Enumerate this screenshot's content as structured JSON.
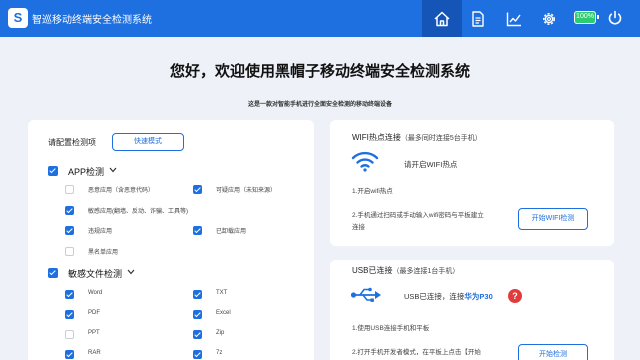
{
  "app": {
    "title": "智巡移动终端安全检测系统",
    "logo_text": "S",
    "nav": [
      {
        "icon": "home-icon"
      },
      {
        "icon": "document-icon"
      },
      {
        "icon": "chart-icon"
      },
      {
        "icon": "gear-icon"
      }
    ],
    "battery": "100%",
    "colors": {
      "primary": "#1e6fe0",
      "accent_red": "#e23b3b",
      "battery_green": "#2ecc71"
    }
  },
  "main": {
    "headline": "您好，欢迎使用黑帽子移动终端安全检测系统",
    "subline": "这是一款对智能手机进行全面安全检测的移动终端设备"
  },
  "config": {
    "title": "请配置检测项",
    "quick_mode": "快速模式",
    "app_group": {
      "label": "APP检测",
      "checked": true,
      "options": [
        {
          "label": "恶意应用（含恶意代码）",
          "checked": false
        },
        {
          "label": "可疑应用（未知来源）",
          "checked": true
        },
        {
          "label": "敏感应用(翻墙、反动、诈骗、工具等)",
          "checked": true
        },
        {
          "label": "违规应用",
          "checked": true
        },
        {
          "label": "已卸载应用",
          "checked": true
        },
        {
          "label": "黑名单应用",
          "checked": false
        }
      ]
    },
    "file_group": {
      "label": "敏感文件检测",
      "checked": true,
      "options": [
        {
          "label": "Word",
          "checked": true
        },
        {
          "label": "TXT",
          "checked": true
        },
        {
          "label": "PDF",
          "checked": true
        },
        {
          "label": "Excel",
          "checked": true
        },
        {
          "label": "PPT",
          "checked": false
        },
        {
          "label": "Zip",
          "checked": true
        },
        {
          "label": "RAR",
          "checked": true
        },
        {
          "label": "7z",
          "checked": true
        }
      ]
    }
  },
  "wifi": {
    "title": "WIFI热点连接",
    "note": "（最多同时连接5台手机）",
    "status": "请开启WIFI热点",
    "step1": "1.开启wifi热点",
    "step2_line1": "2.手机通过扫码或手动输入wifi密码与平板建立",
    "step2_line2": "连接",
    "button": "开始WIFI检测"
  },
  "usb": {
    "title": "USB已连接",
    "note": "（最多连接1台手机）",
    "status_prefix": "USB已连接，连接",
    "device": "华为P30",
    "help": "?",
    "step1": "1.使用USB连接手机和平板",
    "step2": "2.打开手机开发者模式，在平板上点击【开始",
    "button": "开始检测"
  }
}
